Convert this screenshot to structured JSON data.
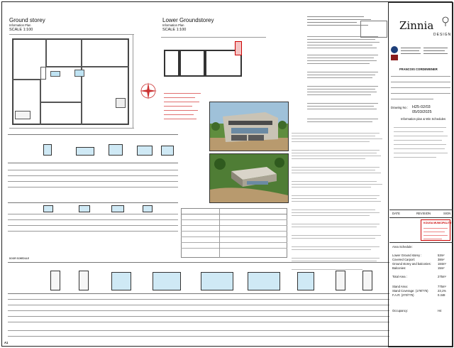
{
  "plans": {
    "ground": {
      "title": "Ground storey",
      "subtitle": "Information Plan",
      "scale": "SCALE 1:100"
    },
    "lower": {
      "title": "Lower Groundstorey",
      "subtitle": "Information Plan",
      "scale": "SCALE 1:100"
    }
  },
  "brand": {
    "name": "Zinnia",
    "sub": "DESIGN"
  },
  "consultant": {
    "name": "FRANCOIS CORDEWENER"
  },
  "project": {
    "drawing_no_label": "Drawing No :",
    "drawing_no": "H25-02/03",
    "date": "05/03/2025",
    "title": "Information plan & Win Schedules"
  },
  "revision_table": {
    "date": "DATE",
    "revision": "REVISION",
    "sign": "SIGN"
  },
  "municipality_stamp": {
    "title": "KOUGA MUNICIPALITY"
  },
  "area_schedule": {
    "title": "Area Schedule:",
    "rows": [
      {
        "label": "Lower Ground storey :",
        "value": "53m²"
      },
      {
        "label": "Covered Carport:",
        "value": "38m²"
      },
      {
        "label": "Ground storey and balconies:",
        "value": "184m²"
      },
      {
        "label": "Balconies:",
        "value": "15m²"
      }
    ],
    "total_label": "Total Area :",
    "total_value": "275m²",
    "stand_rows": [
      {
        "label": "Stand Area:",
        "value": "775m²"
      },
      {
        "label": "Stand Coverage: (179/775)",
        "value": "23,1%"
      },
      {
        "label": "F.A.R: (270/775)",
        "value": "0.348"
      }
    ],
    "occupancy_label": "Occupancy:",
    "occupancy_value": "H4"
  },
  "schedules": {
    "door_title": "DOOR SCHEDULE",
    "sheet_size": "A1"
  },
  "colors": {
    "accent_red": "#cc0000",
    "glass_blue": "#bfe3f3",
    "brand_dark": "#222222"
  },
  "icons": [
    "north-arrow-icon",
    "tree-icon"
  ]
}
